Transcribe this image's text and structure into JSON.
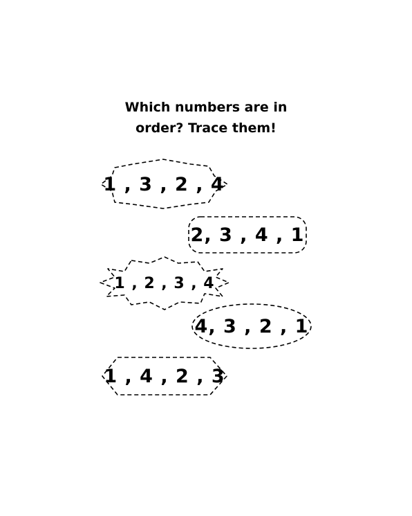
{
  "instructions": {
    "line1": "Which numbers are in",
    "line2": "order? Trace them!"
  },
  "sequences": [
    {
      "label": "1 , 3 , 2 , 4"
    },
    {
      "label": "2, 3 , 4 , 1"
    },
    {
      "label": "1 , 2 , 3 , 4"
    },
    {
      "label": "4, 3 , 2 , 1"
    },
    {
      "label": "1 , 4 , 2 , 3"
    }
  ]
}
